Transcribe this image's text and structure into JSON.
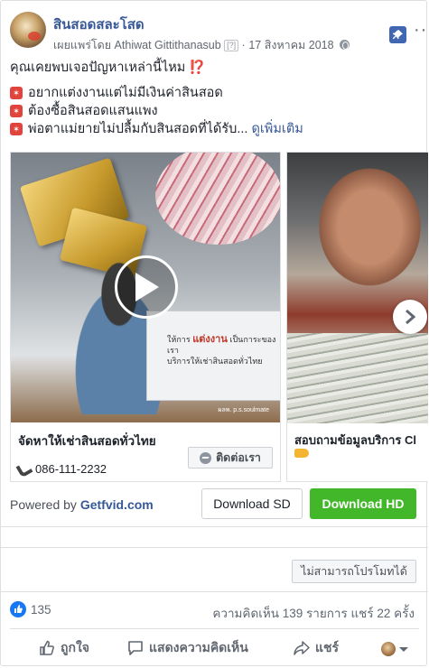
{
  "post": {
    "page_name": "สินสอดสละโสด",
    "published_by": "เผยแพร่โดย Athiwat Gittithanasub",
    "q_mark": "[?]",
    "separator": "·",
    "date": "17 สิงหาคม 2018",
    "line1": "คุณเคยพบเจอปัญหาเหล่านี้ไหม",
    "line1_emoji": "⁉️",
    "bullets": [
      "อยากแต่งงานแต่ไม่มีเงินค่าสินสอด",
      "ต้องซื้อสินสอดแสนแพง",
      "พ่อตาแม่ยายไม่ปลื้มกับสินสอดที่ได้รับ..."
    ],
    "see_more": "ดูเพิ่มเติม"
  },
  "carousel": {
    "card1": {
      "overlay_text_1": "ให้การ",
      "overlay_text_2": "แต่งงาน",
      "overlay_text_3": "เป็นการะของเรา",
      "overlay_text_4": "บริการให้เช่าสินสอดทั่วไทย",
      "watermark": "ผลพ. p.s.soulmate",
      "caption": "จัดหาให้เช่าสินสอดทั่วไทย",
      "phone": "086-111-2232",
      "contact_label": "ติดต่อเรา"
    },
    "card2": {
      "caption": "สอบถามข้อมูลบริการ Cl"
    }
  },
  "download": {
    "powered_prefix": "Powered by ",
    "powered_brand": "Getfvid.com",
    "sd_label": "Download SD",
    "hd_label": "Download HD"
  },
  "promote": {
    "label": "ไม่สามารถโปรโมทได้"
  },
  "engagement": {
    "likes": "135",
    "stats": "ความคิดเห็น 139 รายการ  แชร์ 22 ครั้ง"
  },
  "actions": {
    "like": "ถูกใจ",
    "comment": "แสดงความคิดเห็น",
    "share": "แชร์"
  },
  "colors": {
    "link": "#385898",
    "hd_button": "#42b72a",
    "like_blue": "#1877f2"
  }
}
